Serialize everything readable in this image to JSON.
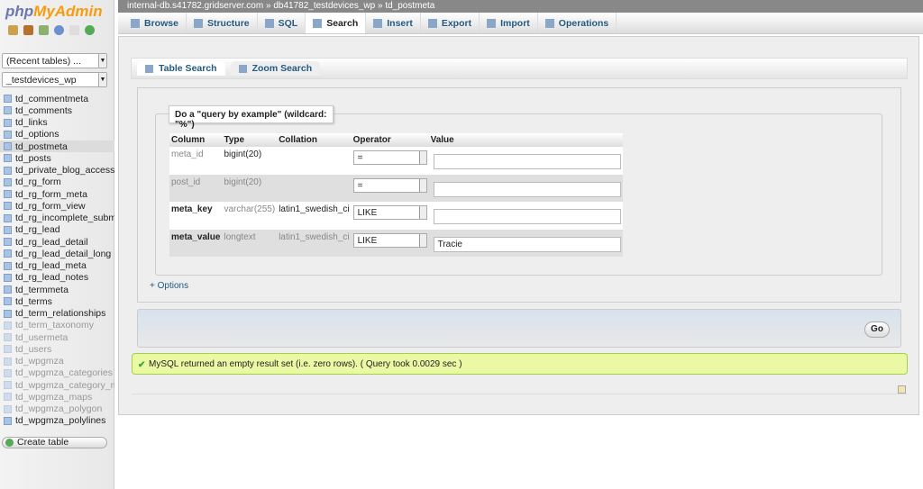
{
  "app": {
    "logo_php": "php",
    "logo_my": "MyAdmin"
  },
  "sidebar": {
    "recent": "(Recent tables) ...",
    "database": "_testdevices_wp",
    "tables": [
      {
        "name": "td_commentmeta",
        "state": "normal"
      },
      {
        "name": "td_comments",
        "state": "normal"
      },
      {
        "name": "td_links",
        "state": "normal"
      },
      {
        "name": "td_options",
        "state": "normal"
      },
      {
        "name": "td_postmeta",
        "state": "selected"
      },
      {
        "name": "td_posts",
        "state": "normal"
      },
      {
        "name": "td_private_blog_access_logs",
        "state": "normal"
      },
      {
        "name": "td_rg_form",
        "state": "normal"
      },
      {
        "name": "td_rg_form_meta",
        "state": "normal"
      },
      {
        "name": "td_rg_form_view",
        "state": "normal"
      },
      {
        "name": "td_rg_incomplete_submissions",
        "state": "normal"
      },
      {
        "name": "td_rg_lead",
        "state": "normal"
      },
      {
        "name": "td_rg_lead_detail",
        "state": "normal"
      },
      {
        "name": "td_rg_lead_detail_long",
        "state": "normal"
      },
      {
        "name": "td_rg_lead_meta",
        "state": "normal"
      },
      {
        "name": "td_rg_lead_notes",
        "state": "normal"
      },
      {
        "name": "td_termmeta",
        "state": "normal"
      },
      {
        "name": "td_terms",
        "state": "normal"
      },
      {
        "name": "td_term_relationships",
        "state": "normal"
      },
      {
        "name": "td_term_taxonomy",
        "state": "dim"
      },
      {
        "name": "td_usermeta",
        "state": "dim"
      },
      {
        "name": "td_users",
        "state": "dim"
      },
      {
        "name": "td_wpgmza",
        "state": "dim"
      },
      {
        "name": "td_wpgmza_categories",
        "state": "dim"
      },
      {
        "name": "td_wpgmza_category_maps",
        "state": "dim"
      },
      {
        "name": "td_wpgmza_maps",
        "state": "dim"
      },
      {
        "name": "td_wpgmza_polygon",
        "state": "dim"
      },
      {
        "name": "td_wpgmza_polylines",
        "state": "normal"
      }
    ],
    "create_table": "Create table"
  },
  "breadcrumb": {
    "server": "internal-db.s41782.gridserver.com",
    "sep": "»",
    "database": "db41782_testdevices_wp",
    "table": "td_postmeta"
  },
  "tabs": [
    {
      "label": "Browse"
    },
    {
      "label": "Structure"
    },
    {
      "label": "SQL"
    },
    {
      "label": "Search",
      "active": true
    },
    {
      "label": "Insert"
    },
    {
      "label": "Export"
    },
    {
      "label": "Import"
    },
    {
      "label": "Operations"
    }
  ],
  "subtabs": [
    {
      "label": "Table Search",
      "active": true
    },
    {
      "label": "Zoom Search"
    }
  ],
  "form": {
    "legend": "Do a \"query by example\" (wildcard: \"%\")",
    "headers": [
      "Column",
      "Type",
      "Collation",
      "Operator",
      "Value"
    ],
    "rows": [
      {
        "column": "meta_id",
        "type": "bigint(20)",
        "collation": "",
        "operator": "=",
        "value": ""
      },
      {
        "column": "post_id",
        "type": "bigint(20)",
        "collation": "",
        "operator": "=",
        "value": ""
      },
      {
        "column": "meta_key",
        "type": "varchar(255)",
        "collation": "latin1_swedish_ci",
        "operator": "LIKE",
        "value": ""
      },
      {
        "column": "meta_value",
        "type": "longtext",
        "collation": "latin1_swedish_ci",
        "operator": "LIKE",
        "value": "Tracie"
      }
    ],
    "options": "+ Options",
    "go": "Go"
  },
  "message": "MySQL returned an empty result set (i.e. zero rows). ( Query took 0.0029 sec )",
  "colors": {
    "accent": "#235a81",
    "success_bg": "#ebf8a4",
    "logo_blue": "#6c78af",
    "logo_orange": "#f89c0e"
  }
}
